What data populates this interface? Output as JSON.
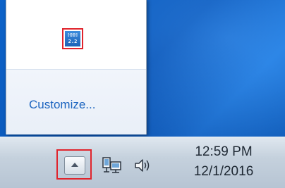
{
  "flyout": {
    "tray_app_icon": "app-tile-icon",
    "tray_app_text_top": "ℍℍℍ",
    "tray_app_text_bottom": "2.2",
    "customize_label": "Customize..."
  },
  "taskbar": {
    "show_hidden_icons_icon": "chevron-up-icon",
    "network_icon": "network-icon",
    "volume_icon": "speaker-volume-icon",
    "clock_time": "12:59 PM",
    "clock_date": "12/1/2016"
  },
  "colors": {
    "desktop_blue": "#0a56b8",
    "link_blue": "#1a63bf",
    "highlight_red": "#e0242c"
  }
}
